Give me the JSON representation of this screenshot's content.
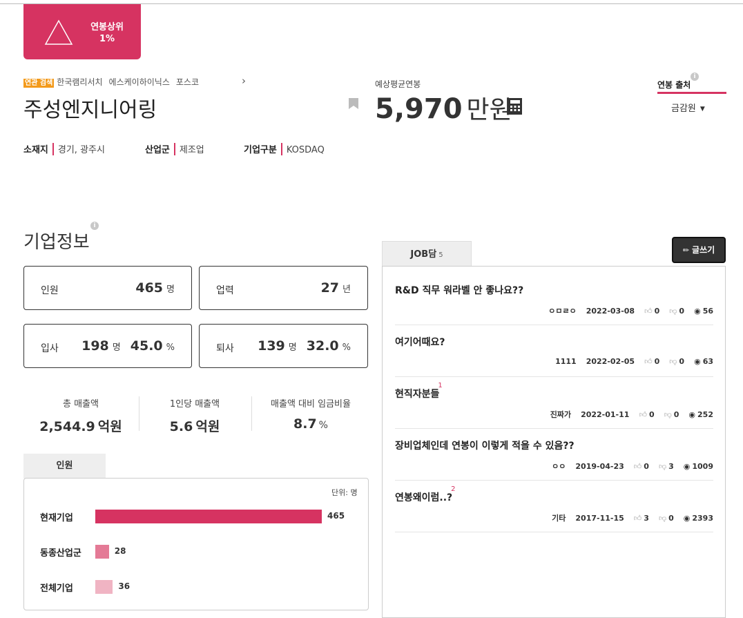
{
  "rank_badge": {
    "line1": "연봉상위",
    "line2": "1%"
  },
  "related_search": {
    "tag": "연관 검색",
    "items": [
      "한국램리서치",
      "에스케이하이닉스",
      "포스코"
    ]
  },
  "company": {
    "name": "주성엔지니어링",
    "location_label": "소재지",
    "location": "경기, 광주시",
    "industry_label": "산업군",
    "industry": "제조업",
    "type_label": "기업구분",
    "type": "KOSDAQ"
  },
  "salary": {
    "label": "예상평균연봉",
    "value": "5,970",
    "unit": "만원"
  },
  "salary_source": {
    "title": "연봉 출처",
    "selected": "금감원"
  },
  "company_info": {
    "title": "기업정보",
    "employees": {
      "label": "인원",
      "value": "465",
      "unit": "명"
    },
    "history": {
      "label": "업력",
      "value": "27",
      "unit": "년"
    },
    "joiners": {
      "label": "입사",
      "value": "198",
      "unit": "명",
      "rate": "45.0",
      "rate_unit": "%"
    },
    "leavers": {
      "label": "퇴사",
      "value": "139",
      "unit": "명",
      "rate": "32.0",
      "rate_unit": "%"
    }
  },
  "financials": [
    {
      "label": "총 매출액",
      "value": "2,544.9",
      "unit": "억원"
    },
    {
      "label": "1인당 매출액",
      "value": "5.6",
      "unit": "억원"
    },
    {
      "label": "매출액 대비 임금비율",
      "value": "8.7",
      "unit": "%"
    }
  ],
  "headcount": {
    "tab": "인원",
    "unit_note": "단위: 명",
    "rows": [
      {
        "label": "현재기업",
        "value": 465,
        "value_text": "465",
        "color": "#d63361"
      },
      {
        "label": "동종산업군",
        "value": 28,
        "value_text": "28",
        "color": "#e47a96"
      },
      {
        "label": "전체기업",
        "value": 36,
        "value_text": "36",
        "color": "#f0b4c3"
      }
    ]
  },
  "job_board": {
    "tab_label": "JOB담",
    "tab_count": "5",
    "write_label": "글쓰기",
    "posts": [
      {
        "title": "R&D 직무 워라벨 안 좋나요??",
        "badge": "",
        "author": "ㅇㅁㄹㅇ",
        "date": "2022-03-08",
        "likes": "0",
        "dislikes": "0",
        "views": "56"
      },
      {
        "title": "여기어때요?",
        "badge": "",
        "author": "1111",
        "date": "2022-02-05",
        "likes": "0",
        "dislikes": "0",
        "views": "63"
      },
      {
        "title": "현직자분들",
        "badge": "1",
        "author": "진짜가",
        "date": "2022-01-11",
        "likes": "0",
        "dislikes": "0",
        "views": "252"
      },
      {
        "title": "장비업체인데 연봉이 이렇게 적을 수 있음??",
        "badge": "",
        "author": "ㅇㅇ",
        "date": "2019-04-23",
        "likes": "0",
        "dislikes": "3",
        "views": "1009"
      },
      {
        "title": "연봉왜이럼..?",
        "badge": "2",
        "author": "기타",
        "date": "2017-11-15",
        "likes": "3",
        "dislikes": "0",
        "views": "2393"
      }
    ]
  },
  "colors": {
    "accent": "#d63361",
    "tag": "#f39a1b"
  }
}
